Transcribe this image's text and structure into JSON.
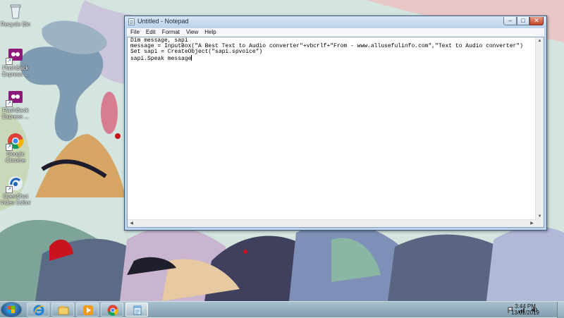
{
  "desktop": {
    "icons": [
      {
        "label": "Recycle Bin",
        "icon": "recycle-bin-icon"
      },
      {
        "label": "FlashBack Express ...",
        "icon": "flashback-express-icon"
      },
      {
        "label": "FlashBack Express ...",
        "icon": "flashback-express-icon"
      },
      {
        "label": "Google Chrome",
        "icon": "chrome-icon"
      },
      {
        "label": "OpenShot Video Editor",
        "icon": "openshot-icon"
      }
    ]
  },
  "window": {
    "title": "Untitled - Notepad",
    "controls": {
      "minimize": "–",
      "maximize": "□",
      "close": "✕"
    },
    "menu": [
      "File",
      "Edit",
      "Format",
      "View",
      "Help"
    ],
    "content": {
      "lines": [
        "Dim message, sapi",
        "message = InputBox(\"A Best Text to Audio converter\"+vbcrlf+\"From - www.allusefulinfo.com\",\"Text to Audio converter\")",
        "Set sapi = CreateObject(\"sapi.spvoice\")",
        "sapi.Speak message"
      ]
    }
  },
  "taskbar": {
    "apps": [
      {
        "name": "Internet Explorer",
        "icon": "internet-explorer-icon"
      },
      {
        "name": "Windows Explorer",
        "icon": "folder-icon"
      },
      {
        "name": "Windows Media Player",
        "icon": "media-player-icon"
      },
      {
        "name": "Google Chrome",
        "icon": "chrome-icon"
      },
      {
        "name": "Notepad",
        "icon": "notepad-icon",
        "active": true
      }
    ],
    "clock": {
      "time": "3:44 PM",
      "date": "13/01/2019"
    }
  }
}
